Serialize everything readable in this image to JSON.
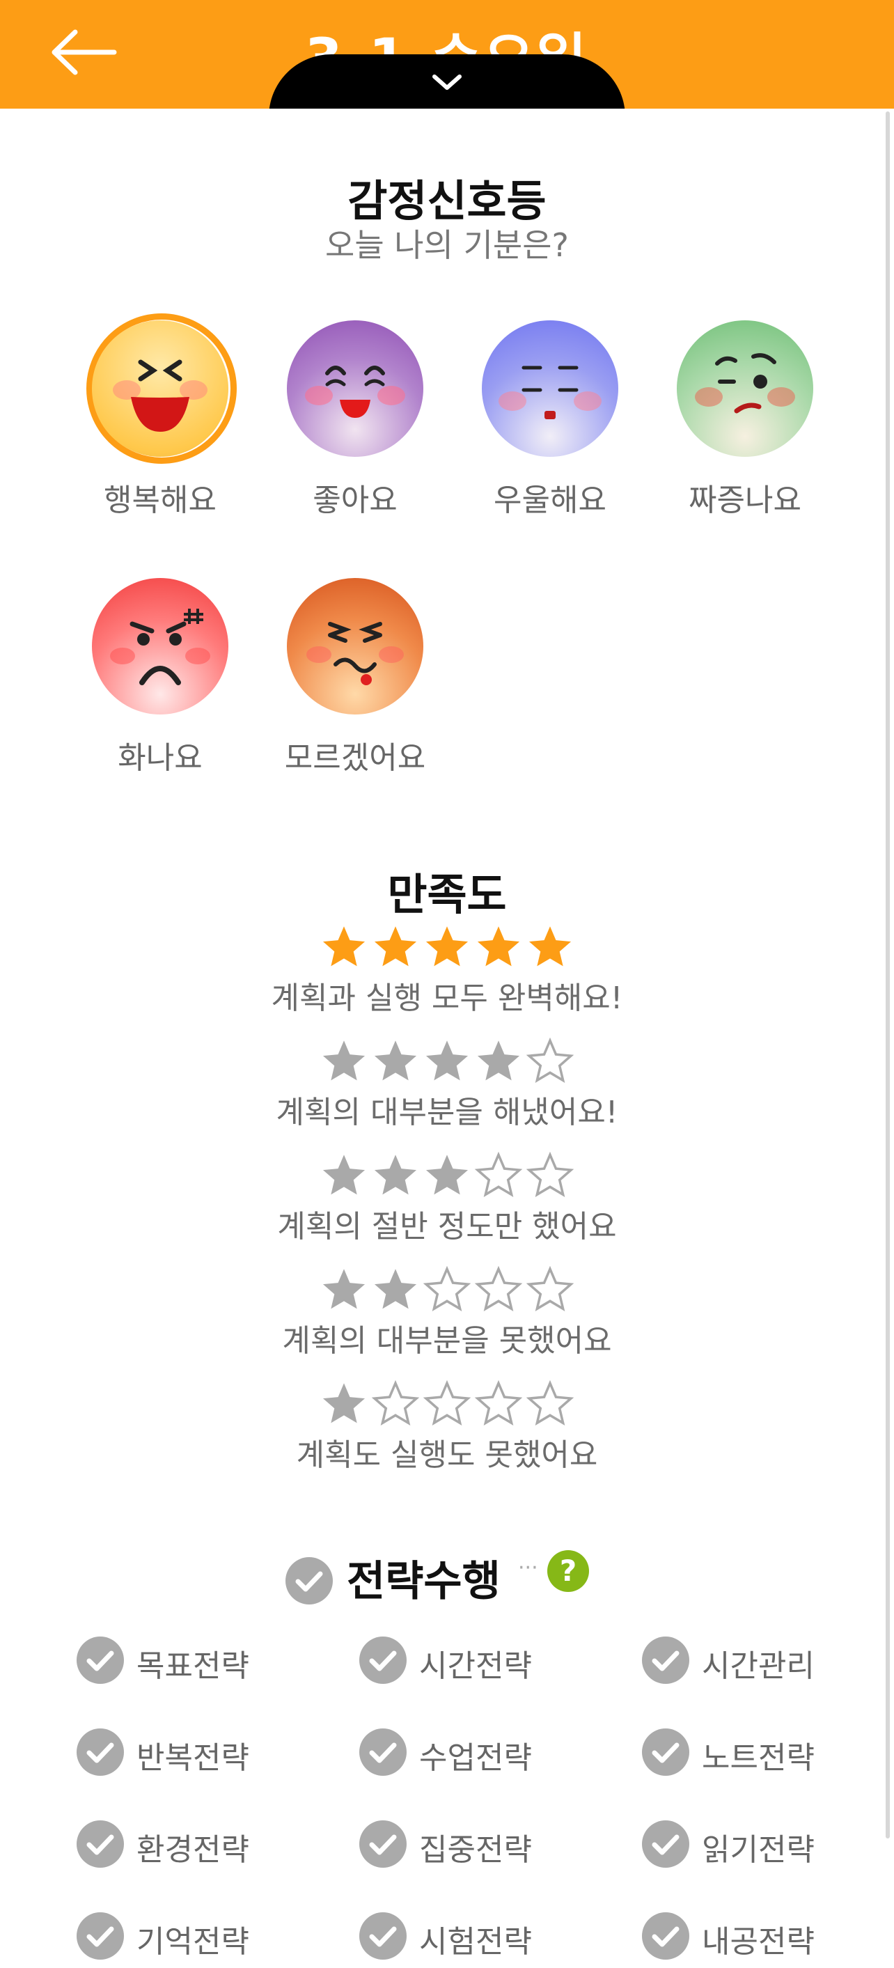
{
  "header": {
    "title": "3.1 수요일",
    "back_icon": "arrow-left-icon",
    "pull_icon": "chevron-down-icon",
    "bg_color": "#fd9d15"
  },
  "emotion": {
    "title": "감정신호등",
    "subtitle": "오늘 나의 기분은?",
    "selected": "happy",
    "items": [
      {
        "id": "happy",
        "label": "행복해요",
        "icon": "happy-face-icon"
      },
      {
        "id": "good",
        "label": "좋아요",
        "icon": "smiling-face-icon"
      },
      {
        "id": "sad",
        "label": "우울해요",
        "icon": "gloomy-face-icon"
      },
      {
        "id": "annoyed",
        "label": "짜증나요",
        "icon": "annoyed-face-icon"
      },
      {
        "id": "angry",
        "label": "화나요",
        "icon": "angry-face-icon"
      },
      {
        "id": "unsure",
        "label": "모르겠어요",
        "icon": "confused-face-icon"
      }
    ]
  },
  "satisfaction": {
    "title": "만족도",
    "selected_stars": 5,
    "options": [
      {
        "stars": 5,
        "label": "계획과 실행 모두 완벽해요!"
      },
      {
        "stars": 4,
        "label": "계획의 대부분을 해냈어요!"
      },
      {
        "stars": 3,
        "label": "계획의 절반 정도만 했어요"
      },
      {
        "stars": 2,
        "label": "계획의 대부분을 못했어요"
      },
      {
        "stars": 1,
        "label": "계획도 실행도 못했어요"
      }
    ]
  },
  "strategy": {
    "title": "전략수행",
    "help_symbol": "?",
    "items": [
      "목표전략",
      "시간전략",
      "시간관리",
      "반복전략",
      "수업전략",
      "노트전략",
      "환경전략",
      "집중전략",
      "읽기전략",
      "기억전략",
      "시험전략",
      "내공전략"
    ]
  }
}
